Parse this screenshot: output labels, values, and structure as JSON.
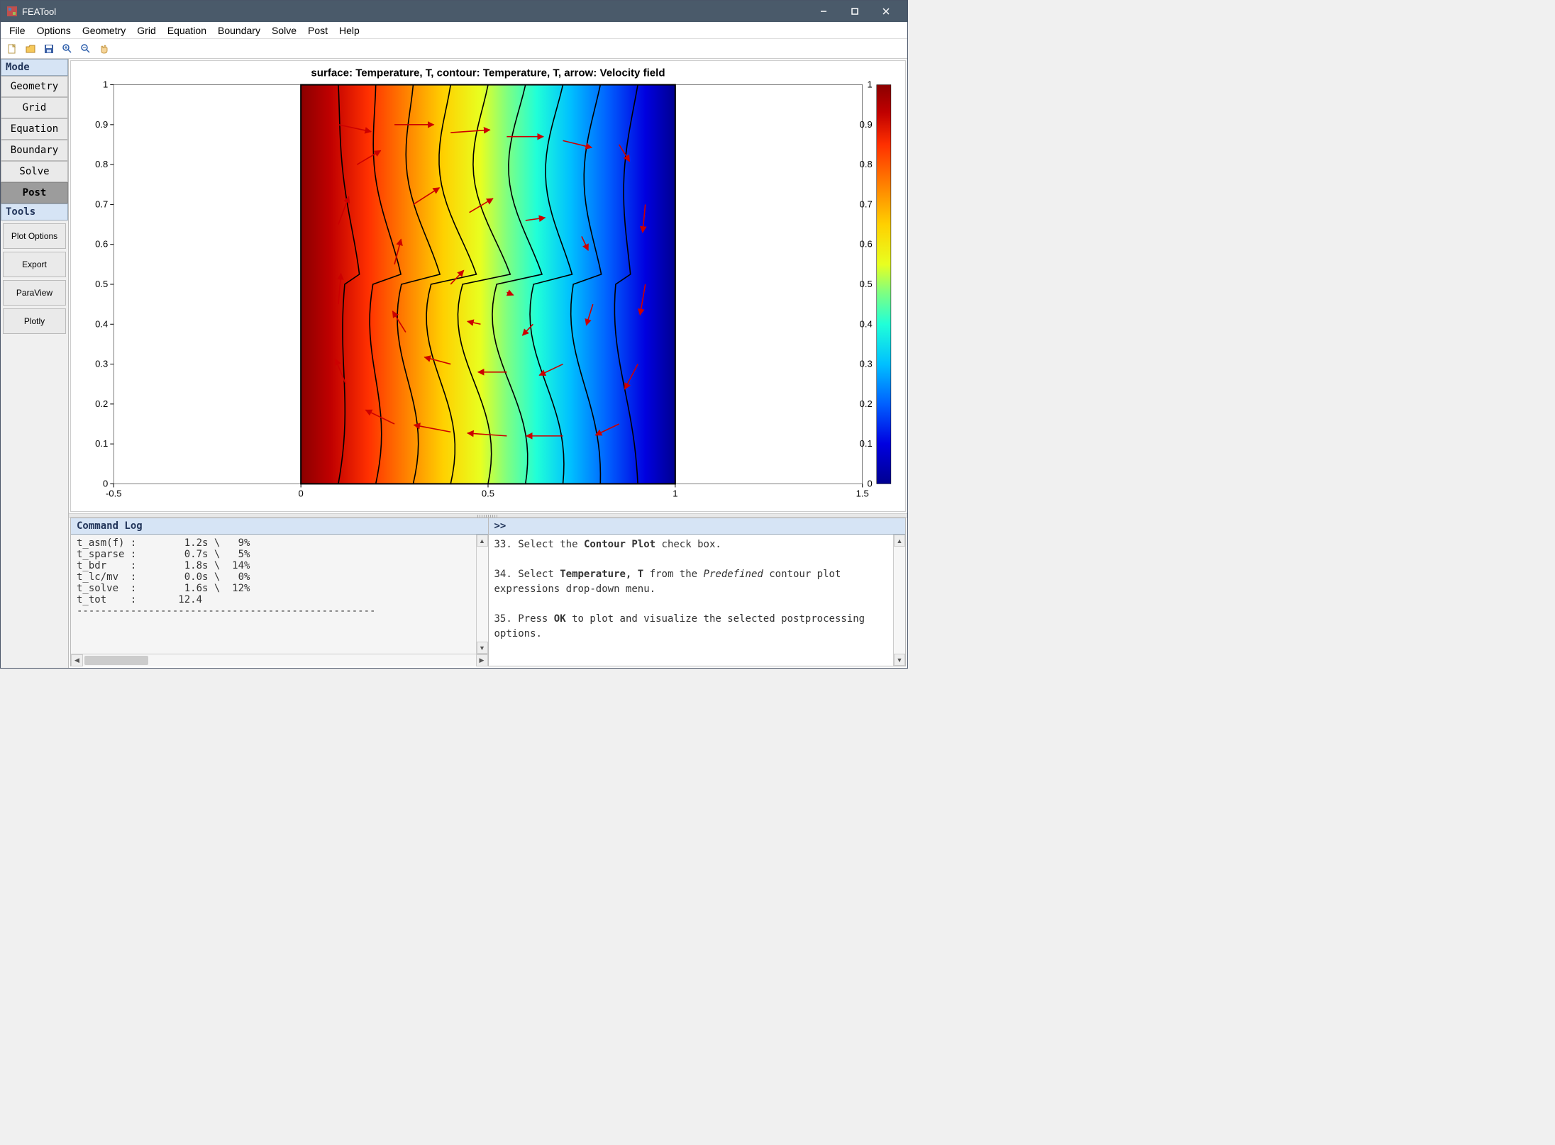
{
  "window": {
    "title": "FEATool"
  },
  "menubar": [
    "File",
    "Options",
    "Geometry",
    "Grid",
    "Equation",
    "Boundary",
    "Solve",
    "Post",
    "Help"
  ],
  "sidebar": {
    "mode_header": "Mode",
    "modes": [
      "Geometry",
      "Grid",
      "Equation",
      "Boundary",
      "Solve",
      "Post"
    ],
    "active_mode": "Post",
    "tools_header": "Tools",
    "tools": [
      "Plot Options",
      "Export",
      "ParaView",
      "Plotly"
    ]
  },
  "plot": {
    "title": "surface: Temperature, T, contour: Temperature, T, arrow: Velocity field",
    "x_ticks": [
      "-0.5",
      "0",
      "0.5",
      "1",
      "1.5"
    ],
    "y_ticks": [
      "0",
      "0.1",
      "0.2",
      "0.3",
      "0.4",
      "0.5",
      "0.6",
      "0.7",
      "0.8",
      "0.9",
      "1"
    ],
    "cbar_ticks": [
      "0",
      "0.1",
      "0.2",
      "0.3",
      "0.4",
      "0.5",
      "0.6",
      "0.7",
      "0.8",
      "0.9",
      "1"
    ]
  },
  "log": {
    "header": "Command Log",
    "lines": [
      "t_asm(f) :        1.2s \\   9%",
      "t_sparse :        0.7s \\   5%",
      "t_bdr    :        1.8s \\  14%",
      "t_lc/mv  :        0.0s \\   0%",
      "t_solve  :        1.6s \\  12%",
      "t_tot    :       12.4",
      "--------------------------------------------------"
    ]
  },
  "help": {
    "prompt": ">>",
    "html": "33. Select the <b>Contour Plot</b> check box.<br><br>34. Select <b>Temperature, T</b> from the <i>Predefined</i> contour plot expressions drop-down menu.<br><br>35. Press <b>OK</b> to plot and visualize the selected postprocessing options."
  },
  "chart_data": {
    "type": "heatmap",
    "title": "surface: Temperature, T, contour: Temperature, T, arrow: Velocity field",
    "xlim": [
      -0.5,
      1.5
    ],
    "ylim": [
      0,
      1
    ],
    "domain": {
      "x": [
        0,
        1
      ],
      "y": [
        0,
        1
      ]
    },
    "surface_variable": "Temperature, T",
    "contour_variable": "Temperature, T",
    "arrow_variable": "Velocity field",
    "colorbar_range": [
      0,
      1
    ],
    "colormap": "jet",
    "contour_levels": [
      0.1,
      0.2,
      0.3,
      0.4,
      0.5,
      0.6,
      0.7,
      0.8,
      0.9
    ],
    "field_note": "T≈1 at x=0 (hot, red) decreasing to T≈0 at x=1 (cold, blue); contours bulge rightward near y≈0.7 and leftward near y≈0.2 indicating convective distortion.",
    "arrows": [
      {
        "x": 0.1,
        "y": 0.9,
        "u": 0.25,
        "v": -0.05
      },
      {
        "x": 0.25,
        "y": 0.9,
        "u": 0.3,
        "v": 0.0
      },
      {
        "x": 0.4,
        "y": 0.88,
        "u": 0.3,
        "v": 0.02
      },
      {
        "x": 0.55,
        "y": 0.87,
        "u": 0.28,
        "v": 0.0
      },
      {
        "x": 0.7,
        "y": 0.86,
        "u": 0.22,
        "v": -0.05
      },
      {
        "x": 0.85,
        "y": 0.85,
        "u": 0.08,
        "v": -0.12
      },
      {
        "x": 0.92,
        "y": 0.7,
        "u": -0.02,
        "v": -0.2
      },
      {
        "x": 0.92,
        "y": 0.5,
        "u": -0.04,
        "v": -0.22
      },
      {
        "x": 0.9,
        "y": 0.3,
        "u": -0.1,
        "v": -0.18
      },
      {
        "x": 0.85,
        "y": 0.15,
        "u": -0.18,
        "v": -0.08
      },
      {
        "x": 0.7,
        "y": 0.12,
        "u": -0.28,
        "v": 0.0
      },
      {
        "x": 0.55,
        "y": 0.12,
        "u": -0.3,
        "v": 0.02
      },
      {
        "x": 0.4,
        "y": 0.13,
        "u": -0.28,
        "v": 0.05
      },
      {
        "x": 0.25,
        "y": 0.15,
        "u": -0.22,
        "v": 0.1
      },
      {
        "x": 0.12,
        "y": 0.25,
        "u": -0.08,
        "v": 0.18
      },
      {
        "x": 0.1,
        "y": 0.45,
        "u": 0.02,
        "v": 0.22
      },
      {
        "x": 0.1,
        "y": 0.65,
        "u": 0.08,
        "v": 0.2
      },
      {
        "x": 0.15,
        "y": 0.8,
        "u": 0.18,
        "v": 0.1
      },
      {
        "x": 0.3,
        "y": 0.7,
        "u": 0.2,
        "v": 0.12
      },
      {
        "x": 0.45,
        "y": 0.68,
        "u": 0.18,
        "v": 0.1
      },
      {
        "x": 0.6,
        "y": 0.66,
        "u": 0.15,
        "v": 0.02
      },
      {
        "x": 0.75,
        "y": 0.62,
        "u": 0.05,
        "v": -0.1
      },
      {
        "x": 0.78,
        "y": 0.45,
        "u": -0.05,
        "v": -0.15
      },
      {
        "x": 0.7,
        "y": 0.3,
        "u": -0.18,
        "v": -0.08
      },
      {
        "x": 0.55,
        "y": 0.28,
        "u": -0.22,
        "v": 0.0
      },
      {
        "x": 0.4,
        "y": 0.3,
        "u": -0.2,
        "v": 0.05
      },
      {
        "x": 0.28,
        "y": 0.38,
        "u": -0.1,
        "v": 0.15
      },
      {
        "x": 0.25,
        "y": 0.55,
        "u": 0.05,
        "v": 0.18
      },
      {
        "x": 0.4,
        "y": 0.5,
        "u": 0.1,
        "v": 0.1
      },
      {
        "x": 0.55,
        "y": 0.48,
        "u": 0.05,
        "v": -0.02
      },
      {
        "x": 0.62,
        "y": 0.4,
        "u": -0.08,
        "v": -0.08
      },
      {
        "x": 0.48,
        "y": 0.4,
        "u": -0.1,
        "v": 0.02
      }
    ]
  }
}
